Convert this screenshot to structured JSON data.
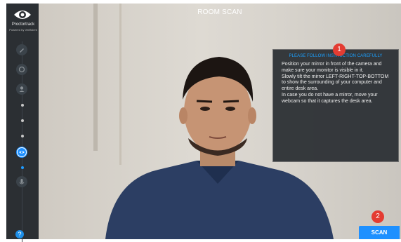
{
  "app": {
    "brand_name": "Proctortrack",
    "brand_tagline": "Powered by Verificient"
  },
  "header": {
    "title": "ROOM SCAN"
  },
  "instructions": {
    "heading": "PLEASE FOLLOW INSTRUCTION CAREFULLY",
    "text": "Position your mirror in front of the camera and make sure your monitor is visible in it.\nSlowly tilt the mirror LEFT-RIGHT-TOP-BOTTOM to show the surrounding of your computer and entire desk area.\nIn case you do not have a mirror, move your webcam so that it captures the desk area."
  },
  "badges": {
    "first": "1",
    "second": "2"
  },
  "actions": {
    "scan_label": "SCAN"
  },
  "sidebar": {
    "help_label": "?",
    "steps": [
      {
        "icon": "pencil-icon"
      },
      {
        "icon": "camera-check-icon"
      },
      {
        "icon": "user-icon"
      },
      {
        "icon": "eye-icon"
      },
      {
        "icon": "microphone-icon"
      }
    ]
  },
  "colors": {
    "accent": "#1e90ff",
    "sidebar_bg": "#2b2f33",
    "badge": "#e43c32",
    "panel_heading": "#1aa0ff"
  }
}
